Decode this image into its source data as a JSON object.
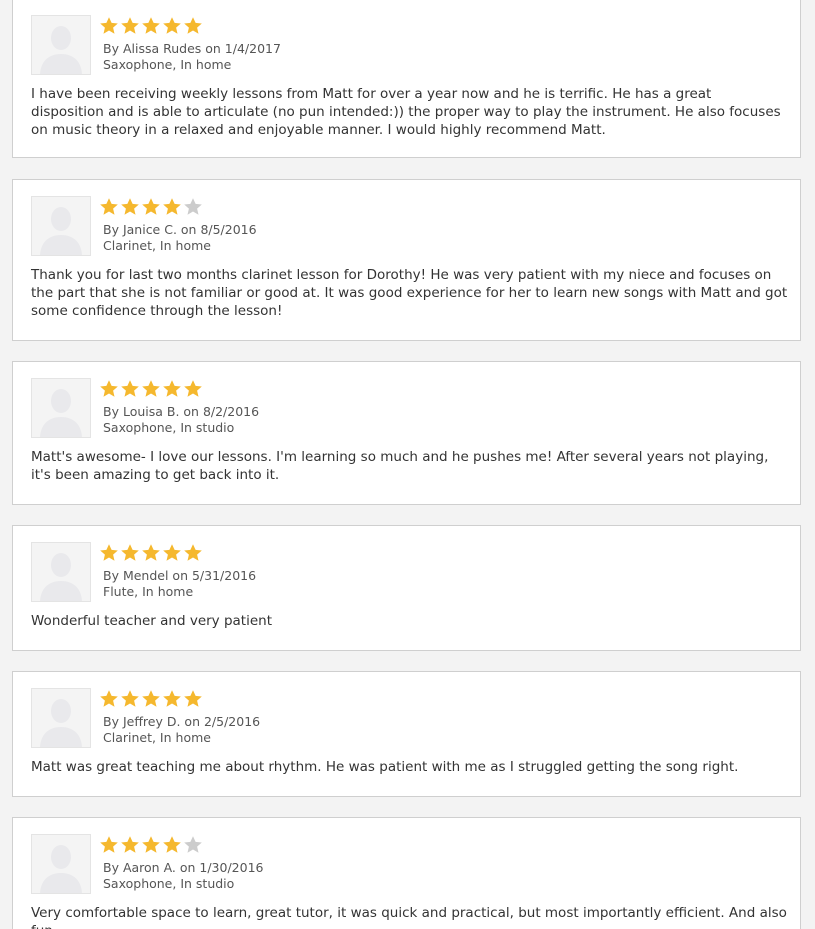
{
  "reviews": [
    {
      "rating": 5,
      "byline": "By Alissa Rudes on 1/4/2017",
      "details": "Saxophone, In home",
      "text": "I have been receiving weekly lessons from Matt for over a year now and he is terrific. He has a great disposition and is able to articulate (no pun intended:)) the proper way to play the instrument. He also focuses on music theory in a relaxed and enjoyable manner. I would highly recommend Matt."
    },
    {
      "rating": 4,
      "byline": "By Janice C. on 8/5/2016",
      "details": "Clarinet, In home",
      "text": "Thank you for last two months clarinet lesson for Dorothy! He was very patient with my niece and focuses on the part that she is not familiar or good at. It was good experience for her to learn new songs with Matt and got some confidence through the lesson!"
    },
    {
      "rating": 5,
      "byline": "By Louisa B. on 8/2/2016",
      "details": "Saxophone, In studio",
      "text": "Matt's awesome- I love our lessons. I'm learning so much and he pushes me! After several years not playing, it's been amazing to get back into it."
    },
    {
      "rating": 5,
      "byline": "By Mendel on 5/31/2016",
      "details": "Flute, In home",
      "text": "Wonderful teacher and very patient"
    },
    {
      "rating": 5,
      "byline": "By Jeffrey D. on 2/5/2016",
      "details": "Clarinet, In home",
      "text": "Matt was great teaching me about rhythm. He was patient with me as I struggled getting the song right."
    },
    {
      "rating": 4,
      "byline": "By Aaron A. on 1/30/2016",
      "details": "Saxophone, In studio",
      "text": "Very comfortable space to learn, great tutor, it was quick and practical, but most importantly efficient. And also fun."
    }
  ],
  "colors": {
    "star_filled": "#f5b82e",
    "star_empty": "#cccccc"
  },
  "icons": {
    "avatar": "default-user-avatar-icon",
    "star": "star-icon"
  }
}
